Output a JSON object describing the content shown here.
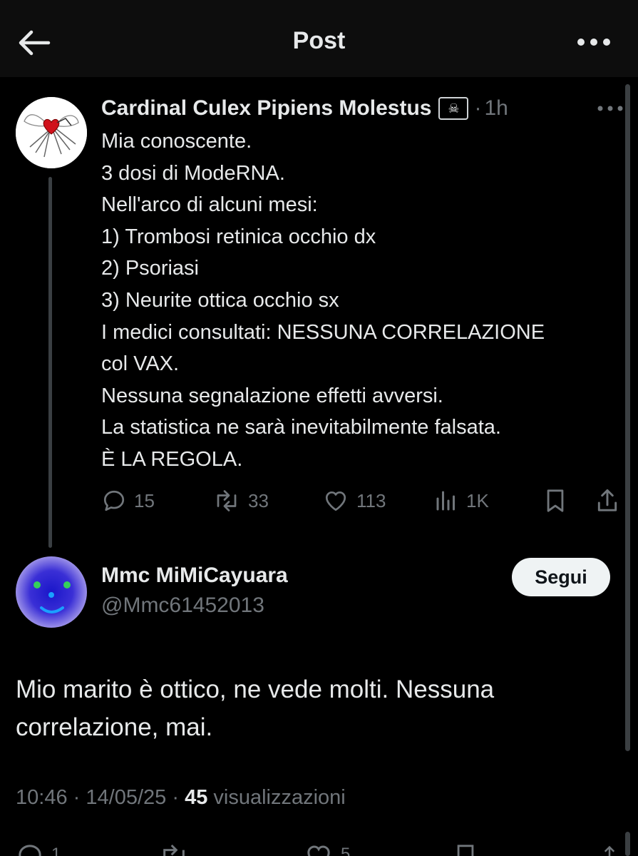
{
  "header": {
    "title": "Post",
    "back_icon": "arrow-left-icon",
    "more_icon": "ellipsis-icon"
  },
  "parent_post": {
    "author_name": "Cardinal Culex Pipiens Molestus",
    "badge_icon": "pirate-flag-icon",
    "badge_glyph": "☠",
    "separator": "·",
    "time_ago": "1h",
    "lines": [
      "Mia conoscente.",
      "3 dosi di ModeRNA.",
      "Nell'arco di alcuni mesi:",
      "1) Trombosi retinica occhio dx",
      "2) Psoriasi",
      "3) Neurite ottica occhio sx",
      "I medici consultati: NESSUNA CORRELAZIONE",
      "col VAX.",
      "Nessuna segnalazione effetti avversi.",
      "La statistica ne sarà inevitabilmente falsata.",
      "È LA REGOLA."
    ],
    "actions": {
      "replies": "15",
      "reposts": "33",
      "likes": "113",
      "views": "1K"
    }
  },
  "reply_post": {
    "author_name": "Mmc MiMiCayuara",
    "handle": "@Mmc61452013",
    "follow_label": "Segui",
    "lines": [
      "Mio marito è ottico, ne vede molti. Nessuna",
      "correlazione, mai."
    ],
    "time": "10:46",
    "dot1": "·",
    "date": "14/05/25",
    "dot2": "·",
    "views_count": "45",
    "views_label": "visualizzazioni",
    "actions": {
      "replies": "1",
      "likes": "5"
    }
  },
  "colors": {
    "background": "#000000",
    "text": "#e7e9ea",
    "muted": "#71767b",
    "button_bg": "#eff3f4"
  }
}
